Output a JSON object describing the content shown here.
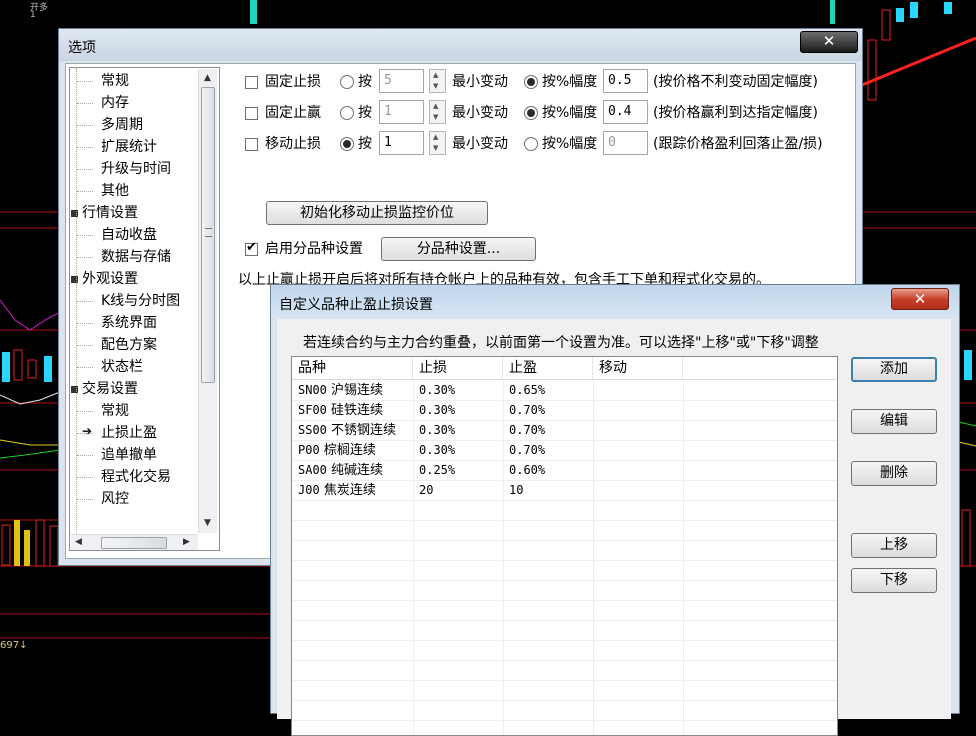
{
  "background": {
    "corner_text": [
      "开多",
      "1"
    ],
    "bottom_number": "697",
    "bottom_arrow": "↓"
  },
  "options_dialog": {
    "title": "选项",
    "close_glyph": "✕",
    "tree_items": [
      {
        "label": "常规",
        "level": 1
      },
      {
        "label": "内存",
        "level": 1
      },
      {
        "label": "多周期",
        "level": 1
      },
      {
        "label": "扩展统计",
        "level": 1
      },
      {
        "label": "升级与时间",
        "level": 1
      },
      {
        "label": "其他",
        "level": 1
      },
      {
        "label": "行情设置",
        "level": 0
      },
      {
        "label": "自动收盘",
        "level": 1
      },
      {
        "label": "数据与存储",
        "level": 1
      },
      {
        "label": "外观设置",
        "level": 0
      },
      {
        "label": "K线与分时图",
        "level": 1
      },
      {
        "label": "系统界面",
        "level": 1
      },
      {
        "label": "配色方案",
        "level": 1
      },
      {
        "label": "状态栏",
        "level": 1
      },
      {
        "label": "交易设置",
        "level": 0
      },
      {
        "label": "常规",
        "level": 1
      },
      {
        "label": "止损止盈",
        "level": 1,
        "selected": true
      },
      {
        "label": "追单撤单",
        "level": 1
      },
      {
        "label": "程式化交易",
        "level": 1
      },
      {
        "label": "风控",
        "level": 1
      }
    ],
    "rows": [
      {
        "check_label": "固定止损",
        "checked": false,
        "by_label": "按",
        "by_selected": false,
        "by_value": "5",
        "by_disabled": true,
        "min_change": "最小变动",
        "pct_label": "按%幅度",
        "pct_selected": true,
        "pct_value": "0.5",
        "pct_disabled": false,
        "note": "(按价格不利变动固定幅度)"
      },
      {
        "check_label": "固定止赢",
        "checked": false,
        "by_label": "按",
        "by_selected": false,
        "by_value": "1",
        "by_disabled": true,
        "min_change": "最小变动",
        "pct_label": "按%幅度",
        "pct_selected": true,
        "pct_value": "0.4",
        "pct_disabled": false,
        "note": "(按价格赢利到达指定幅度)"
      },
      {
        "check_label": "移动止损",
        "checked": false,
        "by_label": "按",
        "by_selected": true,
        "by_value": "1",
        "by_disabled": false,
        "min_change": "最小变动",
        "pct_label": "按%幅度",
        "pct_selected": false,
        "pct_value": "0",
        "pct_disabled": true,
        "note": "(跟踪价格盈利回落止盈/损)"
      }
    ],
    "init_button": "初始化移动止损监控价位",
    "enable_variety": {
      "label": "启用分品种设置",
      "checked": true
    },
    "variety_button": "分品种设置...",
    "info_text": "以上止赢止损开启后将对所有持仓帐户上的品种有效，包含手工下单和程式化交易的。"
  },
  "custom_dialog": {
    "title": "自定义品种止盈止损设置",
    "close_glyph": "✕",
    "note": "若连续合约与主力合约重叠，以前面第一个设置为准。可以选择\"上移\"或\"下移\"调整",
    "columns": [
      "品种",
      "止损",
      "止盈",
      "移动"
    ],
    "rows": [
      {
        "code": "SN00",
        "name": "沪锡连续",
        "stop_loss": "0.30%",
        "take_profit": "0.65%",
        "trailing": ""
      },
      {
        "code": "SF00",
        "name": "硅铁连续",
        "stop_loss": "0.30%",
        "take_profit": "0.70%",
        "trailing": ""
      },
      {
        "code": "SS00",
        "name": "不锈钢连续",
        "stop_loss": "0.30%",
        "take_profit": "0.70%",
        "trailing": ""
      },
      {
        "code": "P00",
        "name": "棕榈连续",
        "stop_loss": "0.30%",
        "take_profit": "0.70%",
        "trailing": ""
      },
      {
        "code": "SA00",
        "name": "纯碱连续",
        "stop_loss": "0.25%",
        "take_profit": "0.60%",
        "trailing": ""
      },
      {
        "code": "J00",
        "name": "焦炭连续",
        "stop_loss": "20",
        "take_profit": "10",
        "trailing": ""
      }
    ],
    "buttons": {
      "add": "添加",
      "edit": "编辑",
      "delete": "删除",
      "up": "上移",
      "down": "下移"
    }
  }
}
